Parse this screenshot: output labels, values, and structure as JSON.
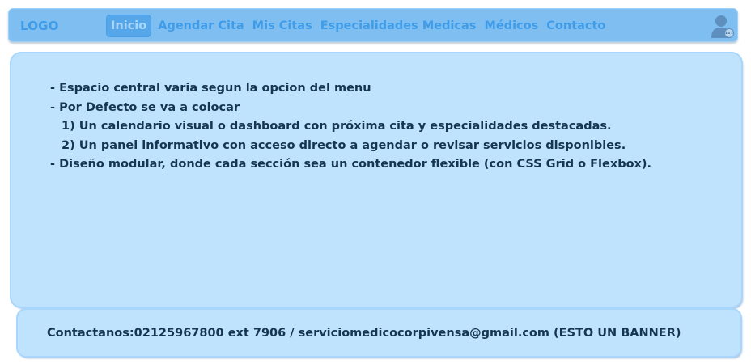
{
  "header": {
    "logo": "LOGO",
    "nav": [
      {
        "label": "Inicio",
        "active": true
      },
      {
        "label": "Agendar Cita",
        "active": false
      },
      {
        "label": "Mis Citas",
        "active": false
      },
      {
        "label": "Especialidades Medicas",
        "active": false
      },
      {
        "label": "Médicos",
        "active": false
      },
      {
        "label": "Contacto",
        "active": false
      }
    ],
    "user_icon": "user-avatar-icon"
  },
  "main": {
    "lines": [
      "- Espacio central varia segun la opcion del menu",
      "- Por Defecto se va a colocar",
      "1) Un calendario visual o dashboard con próxima cita y especialidades destacadas.",
      "2) Un panel informativo con acceso directo a agendar o revisar servicios disponibles.",
      "- Diseño modular, donde cada sección sea un contenedor flexible (con CSS Grid o Flexbox)."
    ]
  },
  "footer": {
    "text": "Contactanos:02125967800 ext 7906 / serviciomedicocorpivensa@gmail.com (ESTO UN BANNER)"
  },
  "colors": {
    "navbar": "#7fbef0",
    "nav_text": "#3f9ce8",
    "panel": "#bfe2fd",
    "text_dark": "#16354f"
  }
}
